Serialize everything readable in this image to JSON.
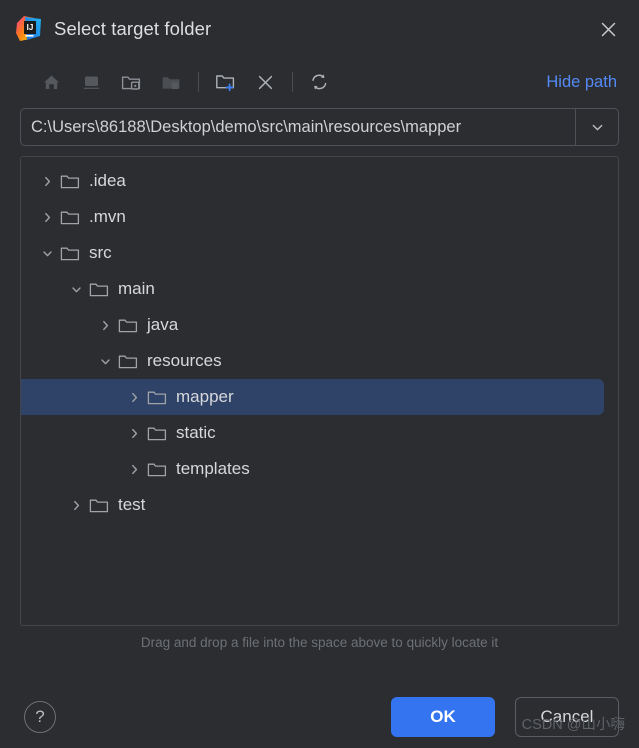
{
  "window": {
    "title": "Select target folder",
    "logo_icon": "intellij-idea-logo",
    "close_icon": "close-icon"
  },
  "toolbar": {
    "buttons": [
      {
        "name": "home-icon",
        "tooltip": "Home",
        "enabled": true
      },
      {
        "name": "desktop-icon",
        "tooltip": "Desktop",
        "enabled": true
      },
      {
        "name": "project-folder-icon",
        "tooltip": "Project Directory",
        "enabled": true
      },
      {
        "name": "module-folder-icon",
        "tooltip": "Module Directory",
        "enabled": false
      },
      {
        "name": "new-folder-icon",
        "tooltip": "New Folder",
        "enabled": true
      },
      {
        "name": "delete-icon",
        "tooltip": "Delete",
        "enabled": true
      },
      {
        "name": "refresh-icon",
        "tooltip": "Refresh",
        "enabled": true
      }
    ],
    "hide_path_label": "Hide path"
  },
  "path": {
    "value": "C:\\Users\\86188\\Desktop\\demo\\src\\main\\resources\\mapper",
    "placeholder": "",
    "dropdown_icon": "chevron-down-icon"
  },
  "tree": {
    "nodes": [
      {
        "label": ".idea",
        "depth": 0,
        "state": "collapsed",
        "selected": false
      },
      {
        "label": ".mvn",
        "depth": 0,
        "state": "collapsed",
        "selected": false
      },
      {
        "label": "src",
        "depth": 0,
        "state": "expanded",
        "selected": false
      },
      {
        "label": "main",
        "depth": 1,
        "state": "expanded",
        "selected": false
      },
      {
        "label": "java",
        "depth": 2,
        "state": "collapsed",
        "selected": false
      },
      {
        "label": "resources",
        "depth": 2,
        "state": "expanded",
        "selected": false
      },
      {
        "label": "mapper",
        "depth": 3,
        "state": "collapsed",
        "selected": true
      },
      {
        "label": "static",
        "depth": 3,
        "state": "collapsed",
        "selected": false
      },
      {
        "label": "templates",
        "depth": 3,
        "state": "collapsed",
        "selected": false
      },
      {
        "label": "test",
        "depth": 1,
        "state": "collapsed",
        "selected": false
      }
    ]
  },
  "hint": {
    "text": "Drag and drop a file into the space above to quickly locate it"
  },
  "footer": {
    "help_label": "?",
    "ok_label": "OK",
    "cancel_label": "Cancel"
  },
  "watermark": {
    "text": "CSDN @山小嗨"
  },
  "colors": {
    "background": "#2b2d30",
    "accent": "#3574f0",
    "link": "#548af7",
    "selection": "#2f4267",
    "text": "#d6d8db",
    "hint_text": "#6d7075"
  }
}
